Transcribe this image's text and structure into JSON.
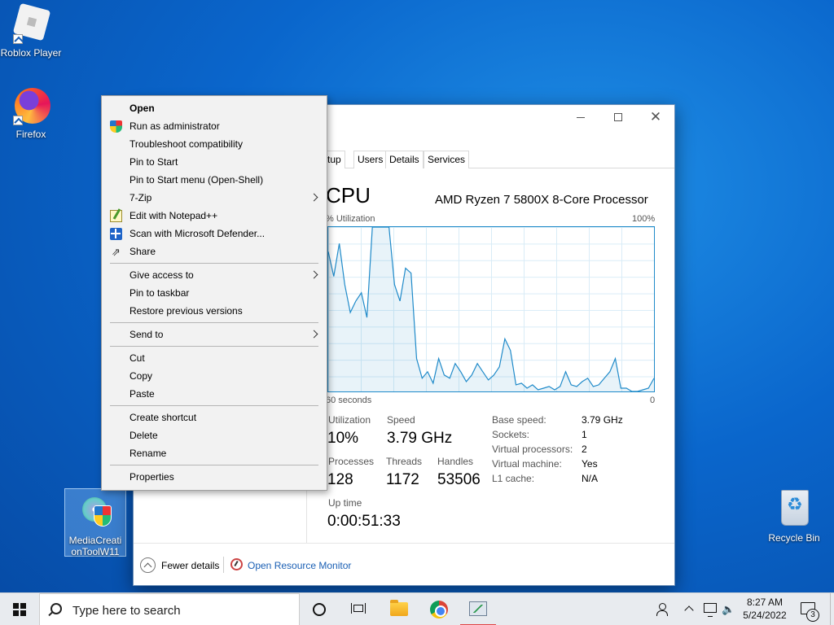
{
  "desktop": {
    "icons": [
      {
        "label": "Roblox Player"
      },
      {
        "label": "Firefox"
      },
      {
        "label": "MediaCreationToolW11"
      },
      {
        "label": "Recycle Bin"
      }
    ]
  },
  "context_menu": {
    "items": [
      {
        "label": "Open"
      },
      {
        "label": "Run as administrator"
      },
      {
        "label": "Troubleshoot compatibility"
      },
      {
        "label": "Pin to Start"
      },
      {
        "label": "Pin to Start menu (Open-Shell)"
      },
      {
        "label": "7-Zip"
      },
      {
        "label": "Edit with Notepad++"
      },
      {
        "label": "Scan with Microsoft Defender..."
      },
      {
        "label": "Share"
      },
      {
        "label": "Give access to"
      },
      {
        "label": "Pin to taskbar"
      },
      {
        "label": "Restore previous versions"
      },
      {
        "label": "Send to"
      },
      {
        "label": "Cut"
      },
      {
        "label": "Copy"
      },
      {
        "label": "Paste"
      },
      {
        "label": "Create shortcut"
      },
      {
        "label": "Delete"
      },
      {
        "label": "Rename"
      },
      {
        "label": "Properties"
      }
    ]
  },
  "task_manager": {
    "tabs": [
      {
        "label": "rtup"
      },
      {
        "label": "Users"
      },
      {
        "label": "Details"
      },
      {
        "label": "Services"
      }
    ],
    "title": "CPU",
    "processor": "AMD Ryzen 7 5800X 8-Core Processor",
    "util_label": "% Utilization",
    "max_label": "100%",
    "time_label": "60 seconds",
    "min_label": "0",
    "graph_color": "#1f8ac9",
    "cpu_history": [
      85,
      70,
      90,
      65,
      48,
      55,
      60,
      45,
      100,
      100,
      100,
      100,
      65,
      55,
      75,
      72,
      20,
      8,
      12,
      5,
      20,
      10,
      8,
      17,
      12,
      6,
      10,
      17,
      12,
      7,
      10,
      15,
      32,
      25,
      4,
      5,
      2,
      4,
      1,
      2,
      3,
      1,
      3,
      12,
      4,
      3,
      6,
      8,
      3,
      4,
      8,
      12,
      20,
      2,
      2,
      0,
      0,
      1,
      2,
      8
    ],
    "stats": {
      "utilization_label": "Utilization",
      "utilization": "10%",
      "speed_label": "Speed",
      "speed": "3.79 GHz",
      "processes_label": "Processes",
      "processes": "128",
      "threads_label": "Threads",
      "threads": "1172",
      "handles_label": "Handles",
      "handles": "53506",
      "uptime_label": "Up time",
      "uptime": "0:00:51:33"
    },
    "specs": [
      {
        "label": "Base speed:",
        "value": "3.79 GHz"
      },
      {
        "label": "Sockets:",
        "value": "1"
      },
      {
        "label": "Virtual processors:",
        "value": "2"
      },
      {
        "label": "Virtual machine:",
        "value": "Yes"
      },
      {
        "label": "L1 cache:",
        "value": "N/A"
      }
    ],
    "footer": {
      "fewer_details": "Fewer details",
      "open_resource_monitor": "Open Resource Monitor"
    }
  },
  "taskbar": {
    "search_placeholder": "Type here to search",
    "clock_time": "8:27 AM",
    "clock_date": "5/24/2022",
    "notification_count": "3"
  }
}
